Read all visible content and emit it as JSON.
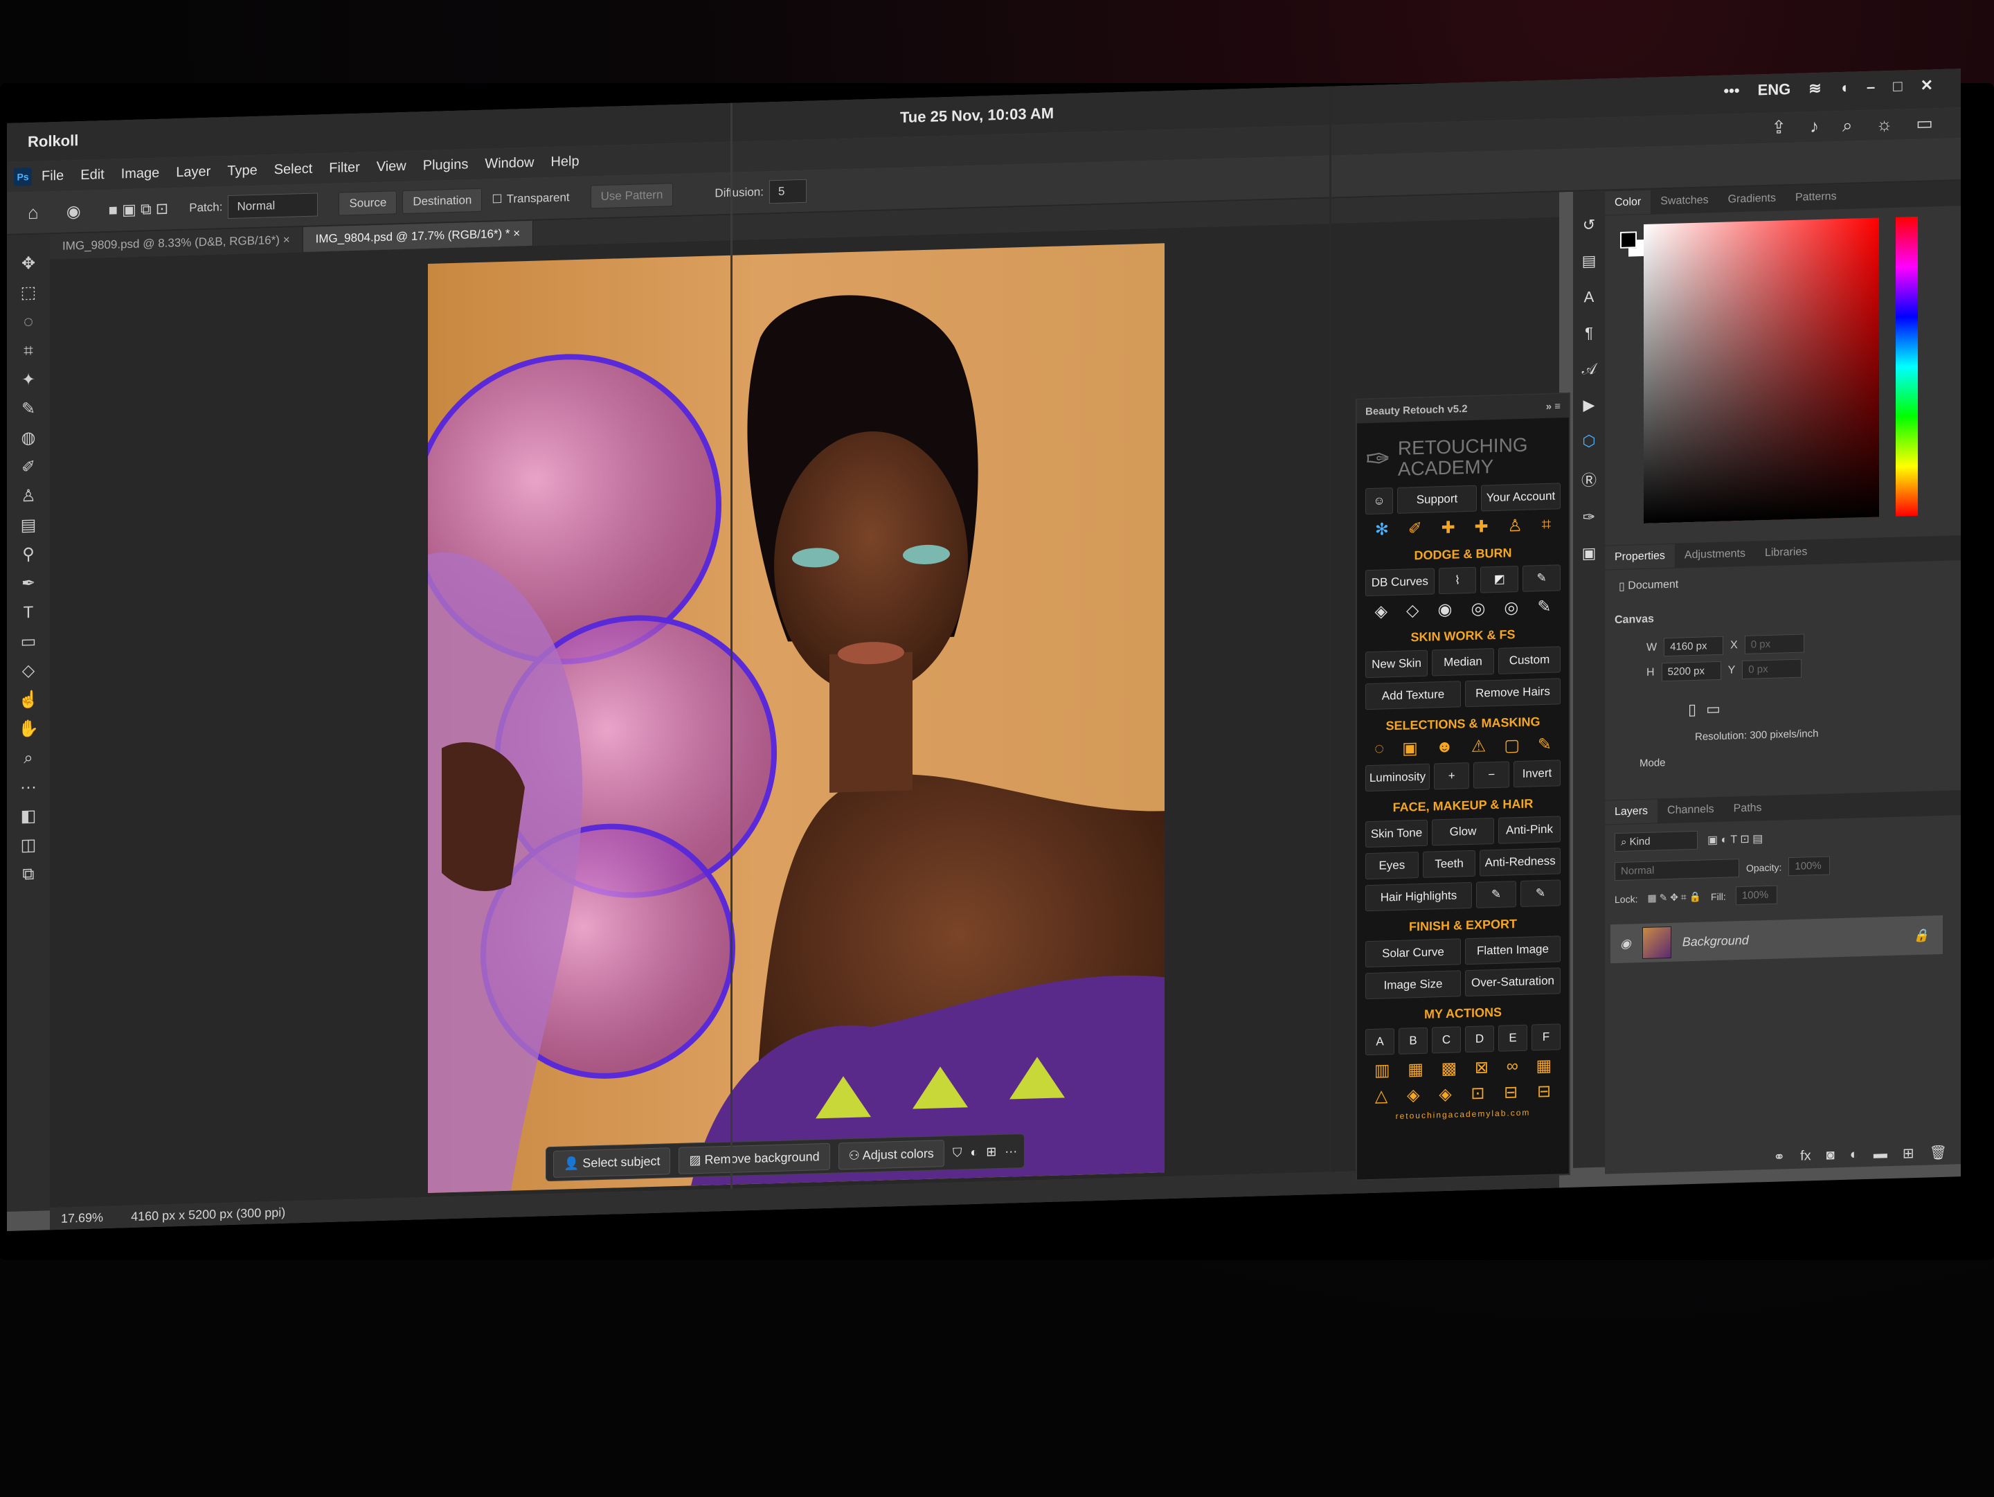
{
  "window": {
    "app_title": "Rolkoll",
    "datetime": "Tue 25 Nov, 10:03 AM",
    "lang": "ENG"
  },
  "menu": [
    "File",
    "Edit",
    "Image",
    "Layer",
    "Type",
    "Select",
    "Filter",
    "View",
    "Plugins",
    "Window",
    "Help"
  ],
  "options": {
    "patch_label": "Patch:",
    "patch_value": "Normal",
    "source": "Source",
    "destination": "Destination",
    "transparent": "Transparent",
    "use_pattern": "Use Pattern",
    "diffusion_label": "Diffusion:",
    "diffusion_value": "5"
  },
  "tabs": [
    {
      "label": "IMG_9809.psd @ 8.33% (D&B, RGB/16*)"
    },
    {
      "label": "IMG_9804.psd @ 17.7% (RGB/16*) *"
    }
  ],
  "context_bar": {
    "select_subject": "Select subject",
    "remove_background": "Remove background",
    "adjust_colors": "Adjust colors"
  },
  "status": {
    "zoom": "17.69%",
    "info": "4160 px x 5200 px (300 ppi)"
  },
  "plugin": {
    "title": "Beauty Retouch v5.2",
    "logo_line1": "RETOUCHING",
    "logo_line2": "ACADEMY",
    "support": "Support",
    "account": "Your Account",
    "dodge_burn": "DODGE & BURN",
    "db_curves": "DB Curves",
    "skin_work": "SKIN WORK & FS",
    "new_skin": "New Skin",
    "median": "Median",
    "custom": "Custom",
    "add_texture": "Add Texture",
    "remove_hairs": "Remove Hairs",
    "selections": "SELECTIONS & MASKING",
    "luminosity": "Luminosity",
    "plus": "+",
    "minus": "−",
    "invert": "Invert",
    "face": "FACE, MAKEUP & HAIR",
    "skin_tone": "Skin Tone",
    "glow": "Glow",
    "anti_pink": "Anti-Pink",
    "eyes": "Eyes",
    "teeth": "Teeth",
    "anti_redness": "Anti-Redness",
    "hair_highlights": "Hair Highlights",
    "finish": "FINISH & EXPORT",
    "solar_curve": "Solar Curve",
    "flatten_image": "Flatten Image",
    "image_size": "Image Size",
    "over_saturation": "Over-Saturation",
    "my_actions": "MY ACTIONS",
    "action_letters": [
      "A",
      "B",
      "C",
      "D",
      "E",
      "F"
    ],
    "url": "retouchingacademylab.com"
  },
  "color_panel": {
    "tabs": [
      "Color",
      "Swatches",
      "Gradients",
      "Patterns"
    ]
  },
  "properties": {
    "tabs": [
      "Properties",
      "Adjustments",
      "Libraries"
    ],
    "document": "Document",
    "canvas": "Canvas",
    "w_label": "W",
    "w_value": "4160 px",
    "h_label": "H",
    "h_value": "5200 px",
    "x_label": "X",
    "x_value": "0 px",
    "y_label": "Y",
    "y_value": "0 px",
    "resolution": "Resolution: 300 pixels/inch",
    "mode": "Mode"
  },
  "layers": {
    "tabs": [
      "Layers",
      "Channels",
      "Paths"
    ],
    "kind": "Kind",
    "blend": "Normal",
    "opacity_label": "Opacity:",
    "opacity_value": "100%",
    "lock_label": "Lock:",
    "fill_label": "Fill:",
    "fill_value": "100%",
    "layer_name": "Background"
  }
}
